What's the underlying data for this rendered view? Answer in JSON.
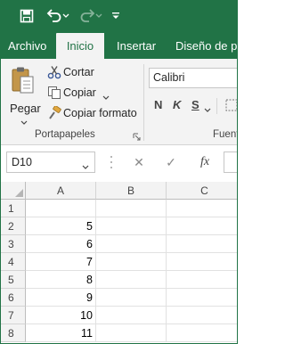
{
  "quick_access": {
    "save_icon": "save-icon",
    "undo_icon": "undo-icon",
    "redo_icon": "redo-icon",
    "customize_icon": "customize-qat-icon"
  },
  "ribbon_tabs": [
    {
      "label": "Archivo",
      "active": false
    },
    {
      "label": "Inicio",
      "active": true
    },
    {
      "label": "Insertar",
      "active": false
    },
    {
      "label": "Diseño de pág",
      "active": false
    }
  ],
  "clipboard_group": {
    "paste_label": "Pegar",
    "cut_label": "Cortar",
    "copy_label": "Copiar",
    "format_painter_label": "Copiar formato",
    "group_label": "Portapapeles"
  },
  "font_group": {
    "font_name": "Calibri",
    "bold_label": "N",
    "italic_label": "K",
    "underline_label": "S",
    "group_label": "Fuente"
  },
  "formula_bar": {
    "name_box": "D10",
    "cancel_symbol": "✕",
    "enter_symbol": "✓",
    "function_label": "fx",
    "formula_value": ""
  },
  "sheet": {
    "columns": [
      "A",
      "B",
      "C"
    ],
    "rows": [
      {
        "num": "1",
        "a": ""
      },
      {
        "num": "2",
        "a": "5"
      },
      {
        "num": "3",
        "a": "6"
      },
      {
        "num": "4",
        "a": "7"
      },
      {
        "num": "5",
        "a": "8"
      },
      {
        "num": "6",
        "a": "9"
      },
      {
        "num": "7",
        "a": "10"
      },
      {
        "num": "8",
        "a": "11"
      }
    ]
  },
  "colors": {
    "brand_green": "#217346",
    "ribbon_bg": "#f3f3f3"
  }
}
